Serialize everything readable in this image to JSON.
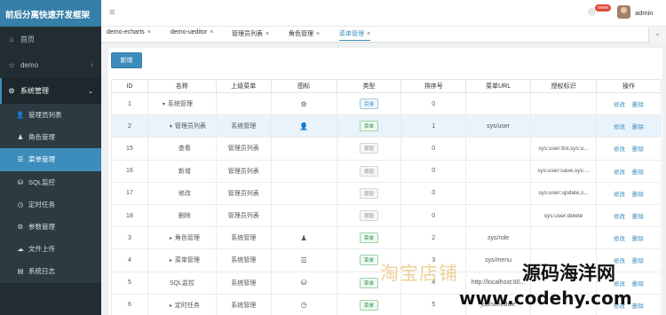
{
  "app": {
    "title": "前后分离快速开发框架"
  },
  "sidebar": {
    "items": [
      {
        "label": "首页",
        "icon": "dashboard-icon",
        "glyph": "⌂"
      },
      {
        "label": "demo",
        "icon": "star-icon",
        "glyph": "☆",
        "chevron": "‹"
      },
      {
        "label": "系统管理",
        "icon": "gear-icon",
        "glyph": "⚙",
        "chevron": "⌄"
      }
    ],
    "submenu": [
      {
        "label": "管理员列表",
        "icon": "user-icon",
        "glyph": "👤"
      },
      {
        "label": "角色管理",
        "icon": "user-secret-icon",
        "glyph": "♟"
      },
      {
        "label": "菜单管理",
        "icon": "list-icon",
        "glyph": "☰"
      },
      {
        "label": "SQL监控",
        "icon": "database-icon",
        "glyph": "⛁"
      },
      {
        "label": "定时任务",
        "icon": "clock-icon",
        "glyph": "◷"
      },
      {
        "label": "参数管理",
        "icon": "cog-icon",
        "glyph": "⚙"
      },
      {
        "label": "文件上传",
        "icon": "cloud-upload-icon",
        "glyph": "☁"
      },
      {
        "label": "系统日志",
        "icon": "file-icon",
        "glyph": "▤"
      }
    ],
    "active_submenu": "菜单管理"
  },
  "header": {
    "menu_glyph": "≡",
    "bell_glyph": "◎",
    "notification_badge": "none",
    "username": "admin"
  },
  "tabs": [
    {
      "label": "demo-echarts",
      "close": "×"
    },
    {
      "label": "demo-ueditor",
      "close": "×"
    },
    {
      "label": "管理员列表",
      "close": "×"
    },
    {
      "label": "角色管理",
      "close": "×"
    },
    {
      "label": "菜单管理",
      "close": "×"
    }
  ],
  "tabs_dropdown_glyph": "⌄",
  "toolbar": {
    "add_label": "新增"
  },
  "table": {
    "columns": [
      "ID",
      "名称",
      "上级菜单",
      "图标",
      "类型",
      "排序号",
      "菜单URL",
      "授权标识",
      "操作"
    ],
    "edit_label": "修改",
    "delete_label": "删除",
    "rows": [
      {
        "id": "1",
        "name": "系统管理",
        "level": "top",
        "caret": "▾",
        "parent": "",
        "icon_glyph": "⚙",
        "type": "目录",
        "type_kind": "dir",
        "sort": "0",
        "url": "",
        "perm": ""
      },
      {
        "id": "2",
        "name": "管理员列表",
        "level": "mid",
        "caret": "▾",
        "parent": "系统管理",
        "icon_glyph": "👤",
        "type": "菜单",
        "type_kind": "menu",
        "sort": "1",
        "url": "sys/user",
        "perm": "",
        "highlight": true
      },
      {
        "id": "15",
        "name": "查看",
        "level": "leaf",
        "caret": "",
        "parent": "管理员列表",
        "icon_glyph": "",
        "type": "按钮",
        "type_kind": "btn",
        "sort": "0",
        "url": "",
        "perm": "sys:user:list,sys:u..."
      },
      {
        "id": "16",
        "name": "新增",
        "level": "leaf",
        "caret": "",
        "parent": "管理员列表",
        "icon_glyph": "",
        "type": "按钮",
        "type_kind": "btn",
        "sort": "0",
        "url": "",
        "perm": "sys:user:save,sys:..."
      },
      {
        "id": "17",
        "name": "修改",
        "level": "leaf",
        "caret": "",
        "parent": "管理员列表",
        "icon_glyph": "",
        "type": "按钮",
        "type_kind": "btn",
        "sort": "0",
        "url": "",
        "perm": "sys:user:update,s..."
      },
      {
        "id": "18",
        "name": "删除",
        "level": "leaf",
        "caret": "",
        "parent": "管理员列表",
        "icon_glyph": "",
        "type": "按钮",
        "type_kind": "btn",
        "sort": "0",
        "url": "",
        "perm": "sys:user:delete"
      },
      {
        "id": "3",
        "name": "角色管理",
        "level": "mid",
        "caret": "▸",
        "parent": "系统管理",
        "icon_glyph": "♟",
        "type": "菜单",
        "type_kind": "menu",
        "sort": "2",
        "url": "sys/role",
        "perm": ""
      },
      {
        "id": "4",
        "name": "菜单管理",
        "level": "mid",
        "caret": "▸",
        "parent": "系统管理",
        "icon_glyph": "☰",
        "type": "菜单",
        "type_kind": "menu",
        "sort": "3",
        "url": "sys/menu",
        "perm": ""
      },
      {
        "id": "5",
        "name": "SQL监控",
        "level": "mid",
        "caret": "",
        "parent": "系统管理",
        "icon_glyph": "⛁",
        "type": "菜单",
        "type_kind": "menu",
        "sort": "4",
        "url": "http://localhost:80...",
        "perm": ""
      },
      {
        "id": "6",
        "name": "定时任务",
        "level": "mid",
        "caret": "▸",
        "parent": "系统管理",
        "icon_glyph": "◷",
        "type": "菜单",
        "type_kind": "menu",
        "sort": "5",
        "url": "job/schedule",
        "perm": ""
      }
    ]
  },
  "watermark": {
    "line1": "淘宝店铺",
    "line2": "源码海洋网",
    "line3": "www.codehy.com"
  },
  "colors": {
    "sidebar_bg": "#222d32",
    "brand_bg": "#367fa9",
    "accent": "#3c8dbc"
  }
}
